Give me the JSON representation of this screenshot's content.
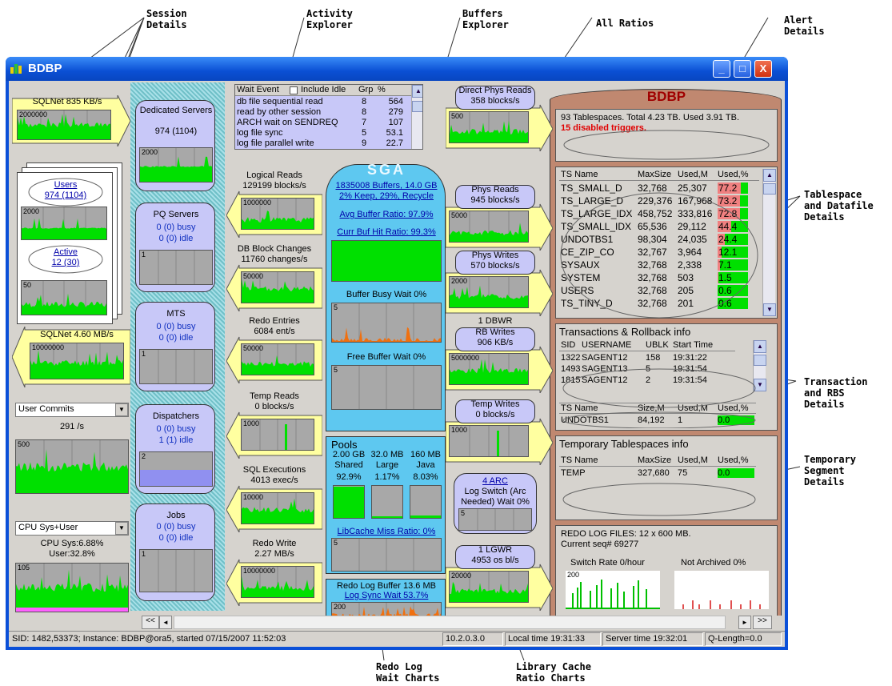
{
  "callouts": {
    "session_details": "Session\nDetails",
    "activity_explorer": "Activity\nExplorer",
    "buffers_explorer": "Buffers\nExplorer",
    "all_ratios": "All Ratios",
    "alert_details": "Alert\nDetails",
    "tablespace_details": "Tablespace\nand Datafile\nDetails",
    "transaction_details": "Transaction\nand RBS\nDetails",
    "temporary_details": "Temporary\nSegment\nDetails",
    "redo_log_wait": "Redo Log\nWait Charts",
    "library_cache": "Library Cache\nRatio Charts"
  },
  "window": {
    "title": "BDBP",
    "min": "_",
    "max": "□",
    "close": "X"
  },
  "left": {
    "sqlnet_in": "SQLNet  835 KB/s",
    "sqlnet_in_max": "2000000",
    "users_link": "Users",
    "users_val": "974 (1104)",
    "users_chart_max": "2000",
    "active_link": "Active",
    "active_val": "12 (30)",
    "active_chart_max": "50",
    "sqlnet_out": "SQLNet  4.60 MB/s",
    "sqlnet_out_max": "10000000",
    "commits_combo": "User Commits",
    "commits_val": "291 /s",
    "commits_chart_max": "500",
    "cpu_combo": "CPU Sys+User",
    "cpu_sys": "CPU Sys:6.88%",
    "cpu_user": "User:32.8%",
    "cpu_chart_max": "105"
  },
  "servers": {
    "dedicated_title": "Dedicated Servers",
    "dedicated_val": "974 (1104)",
    "dedicated_max": "2000",
    "pq_title": "PQ Servers",
    "pq_busy": "0 (0) busy",
    "pq_idle": "0 (0) idle",
    "pq_max": "1",
    "mts_title": "MTS",
    "mts_busy": "0 (0) busy",
    "mts_idle": "0 (0) idle",
    "mts_max": "1",
    "disp_title": "Dispatchers",
    "disp_busy": "0 (0) busy",
    "disp_idle": "1 (1) idle",
    "disp_max": "2",
    "jobs_title": "Jobs",
    "jobs_busy": "0 (0) busy",
    "jobs_idle": "0 (0) idle",
    "jobs_max": "1"
  },
  "wait_events": {
    "col_event": "Wait Event",
    "include_idle": "Include Idle",
    "col_grp": "Grp",
    "col_pct": "%",
    "rows": [
      {
        "event": "db file sequential read",
        "grp": "8",
        "pct": "564"
      },
      {
        "event": "read by other session",
        "grp": "8",
        "pct": "279"
      },
      {
        "event": "ARCH wait on SENDREQ",
        "grp": "7",
        "pct": "107"
      },
      {
        "event": "log file sync",
        "grp": "5",
        "pct": "53.1"
      },
      {
        "event": "log file parallel write",
        "grp": "9",
        "pct": "22.7"
      }
    ]
  },
  "mid_left": {
    "logical_reads": "Logical Reads",
    "logical_reads_val": "129199 blocks/s",
    "logical_max": "1000000",
    "dbblock": "DB Block Changes",
    "dbblock_val": "11760 changes/s",
    "dbblock_max": "50000",
    "redo_entries": "Redo Entries",
    "redo_entries_val": "6084 ent/s",
    "redo_entries_max": "50000",
    "temp_reads": "Temp Reads",
    "temp_reads_val": "0 blocks/s",
    "temp_reads_max": "1000",
    "sql_exec": "SQL Executions",
    "sql_exec_val": "4013 exec/s",
    "sql_exec_max": "10000",
    "redo_write": "Redo Write",
    "redo_write_val": "2.27 MB/s",
    "redo_write_max": "10000000"
  },
  "sga": {
    "title": "SGA",
    "buffers": "1835008 Buffers, 14.0 GB",
    "keep": "2% Keep, 29%, Recycle",
    "avg_ratio": "Avg Buffer Ratio: 97.9%",
    "curr_ratio": "Curr Buf Hit Ratio: 99.3%",
    "busy_wait": "Buffer Busy Wait  0%",
    "busy_max": "5",
    "free_wait": "Free Buffer Wait  0%",
    "free_max": "5",
    "pools": "Pools",
    "pool_sizes": [
      "2.00 GB",
      "32.0 MB",
      "160 MB"
    ],
    "pool_names": [
      "Shared",
      "Large",
      "Java"
    ],
    "pool_pcts": [
      "92.9%",
      "1.17%",
      "8.03%"
    ],
    "libcache": "LibCache Miss Ratio: 0%",
    "libcache_max": "5",
    "redo_buffer": "Redo Log Buffer 13.6 MB",
    "log_sync": "Log Sync Wait  53.7%",
    "redo_max": "200"
  },
  "mid_right": {
    "direct_phys": "Direct Phys Reads",
    "direct_phys_val": "358 blocks/s",
    "direct_max": "500",
    "phys_reads": "Phys Reads",
    "phys_reads_val": "945 blocks/s",
    "phys_reads_max": "5000",
    "phys_writes": "Phys Writes",
    "phys_writes_val": "570 blocks/s",
    "phys_writes_max": "2000",
    "dbwr": "1 DBWR",
    "rb_writes": "RB Writes",
    "rb_writes_val": "906 KB/s",
    "rb_max": "5000000",
    "temp_writes": "Temp Writes",
    "temp_writes_val": "0 blocks/s",
    "temp_writes_max": "1000",
    "arc_link": "4 ARC",
    "log_switch": "Log Switch (Arc",
    "log_switch2": "Needed) Wait 0%",
    "log_switch_max": "5",
    "lgwr": "1 LGWR",
    "lgwr_val": "4953 os bl/s",
    "lgwr_max": "20000"
  },
  "db": {
    "name": "BDBP",
    "summary": "93 Tablespaces.  Total 4.23 TB.  Used 3.91 TB.",
    "alert": "15 disabled triggers.",
    "ts_headers": [
      "TS Name",
      "MaxSize",
      "Used,M",
      "Used,%"
    ],
    "ts_rows": [
      {
        "name": "TS_SMALL_D",
        "max": "32,768",
        "used": "25,307",
        "pct": "77.2",
        "frac": 0.772
      },
      {
        "name": "TS_LARGE_D",
        "max": "229,376",
        "used": "167,968",
        "pct": "73.2",
        "frac": 0.732
      },
      {
        "name": "TS_LARGE_IDX",
        "max": "458,752",
        "used": "333,816",
        "pct": "72.8",
        "frac": 0.728
      },
      {
        "name": "TS_SMALL_IDX",
        "max": "65,536",
        "used": "29,112",
        "pct": "44.4",
        "frac": 0.444
      },
      {
        "name": "UNDOTBS1",
        "max": "98,304",
        "used": "24,035",
        "pct": "24.4",
        "frac": 0.244
      },
      {
        "name": "CE_ZIP_CO",
        "max": "32,767",
        "used": "3,964",
        "pct": "12.1",
        "frac": 0.121
      },
      {
        "name": "SYSAUX",
        "max": "32,768",
        "used": "2,338",
        "pct": "7.1",
        "frac": 0.071
      },
      {
        "name": "SYSTEM",
        "max": "32,768",
        "used": "503",
        "pct": "1.5",
        "frac": 0.015
      },
      {
        "name": "USERS",
        "max": "32,768",
        "used": "205",
        "pct": "0.6",
        "frac": 0.006
      },
      {
        "name": "TS_TINY_D",
        "max": "32,768",
        "used": "201",
        "pct": "0.6",
        "frac": 0.006
      }
    ],
    "tx_title": "Transactions & Rollback info",
    "tx_headers": [
      "SID",
      "USERNAME",
      "UBLK",
      "Start Time"
    ],
    "tx_rows": [
      {
        "sid": "1322",
        "user": "SAGENT12",
        "ublk": "158",
        "time": "19:31:22"
      },
      {
        "sid": "1493",
        "user": "SAGENT13",
        "ublk": "5",
        "time": "19:31:54"
      },
      {
        "sid": "1815",
        "user": "SAGENT12",
        "ublk": "2",
        "time": "19:31:54"
      }
    ],
    "rbs_headers": [
      "TS Name",
      "Size,M",
      "Used,M",
      "Used,%"
    ],
    "rbs_row": {
      "name": "UNDOTBS1",
      "size": "84,192",
      "used": "1",
      "pct": "0.0"
    },
    "temp_title": "Temporary Tablespaces info",
    "temp_headers": [
      "TS Name",
      "MaxSize",
      "Used,M",
      "Used,%"
    ],
    "temp_row": {
      "name": "TEMP",
      "max": "327,680",
      "used": "75",
      "pct": "0.0"
    },
    "redo_files": "REDO LOG FILES: 12 x 600 MB.",
    "redo_seq": "Current seq# 69277",
    "switch_rate": "Switch Rate 0/hour",
    "switch_max": "200",
    "not_archived": "Not Archived 0%"
  },
  "status": {
    "sid": "SID: 1482,53373; Instance: BDBP@ora5, started 07/15/2007 11:52:03",
    "version": "10.2.0.3.0",
    "local_time": "Local time 19:31:33",
    "server_time": "Server time 19:32:01",
    "qlength": "Q-Length=0.0"
  },
  "nav": {
    "first": "<<",
    "prev": "◄",
    "next": "►",
    "last": ">>"
  },
  "colors": {
    "chart_bg": "#a8a8a8",
    "chart_green": "#00e000",
    "chart_orange": "#f07010",
    "yellow": "#ffffa0",
    "lavender": "#c8c8f8",
    "sga_blue": "#5ec8f0",
    "brown": "#c08870",
    "alert_red": "#e00000"
  }
}
